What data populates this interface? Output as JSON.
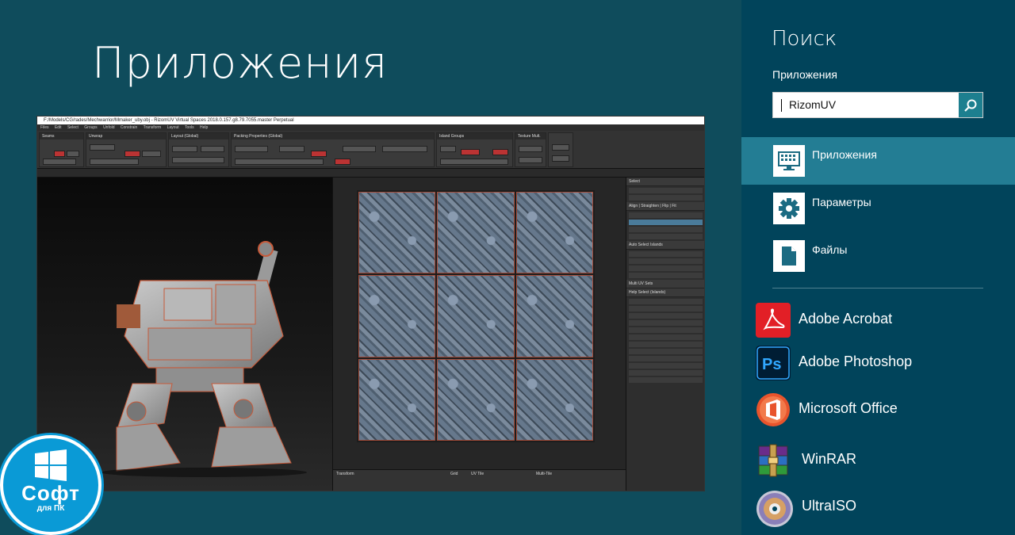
{
  "main": {
    "title": "Приложения",
    "app_window": {
      "title": "F:/Models/CG/rades/Mechwarrior/Mmaker_uby.obj - RizomUV  Virtual Spaces 2018.0.157.g8.79.7055.master Perpetual",
      "menu": [
        "Files",
        "Edit",
        "Select",
        "Groups",
        "Unfold",
        "Constrain",
        "Transform",
        "Layout",
        "Tools",
        "Help"
      ],
      "ribbon_groups": [
        "Seams",
        "Unwrap",
        "Layout (Global)",
        "Packing Properties (Global)",
        "Island Groups",
        "Texture Mult."
      ],
      "side_panel": {
        "select_header": "Select",
        "align_header": "Align | Straighten | Flip | Fit",
        "auto_select_header": "Auto Select Islands",
        "multi_uv_header": "Multi UV Sets",
        "help_header": "Help Select (Islands)"
      },
      "bottom_panels": [
        "Transform",
        "Grid",
        "UV Tile",
        "Multi-Tile"
      ]
    }
  },
  "logo": {
    "line1": "Софт",
    "line2": "для ПК"
  },
  "search": {
    "title": "Поиск",
    "scope": "Приложения",
    "query": "RizomUV",
    "categories": [
      {
        "label": "Приложения",
        "icon": "apps-icon",
        "selected": true
      },
      {
        "label": "Параметры",
        "icon": "gear-icon",
        "selected": false
      },
      {
        "label": "Файлы",
        "icon": "file-icon",
        "selected": false
      }
    ],
    "apps": [
      {
        "label": "Adobe Acrobat",
        "icon": "acrobat-icon"
      },
      {
        "label": "Adobe Photoshop",
        "icon": "photoshop-icon"
      },
      {
        "label": "Microsoft Office",
        "icon": "office-icon"
      },
      {
        "label": "WinRAR",
        "icon": "winrar-icon"
      },
      {
        "label": "UltraISO",
        "icon": "ultraiso-icon"
      }
    ]
  },
  "colors": {
    "background": "#0f4c5c",
    "search_pane": "#01445b",
    "selected_category": "#237d94",
    "logo_blue": "#0a9ad6"
  }
}
